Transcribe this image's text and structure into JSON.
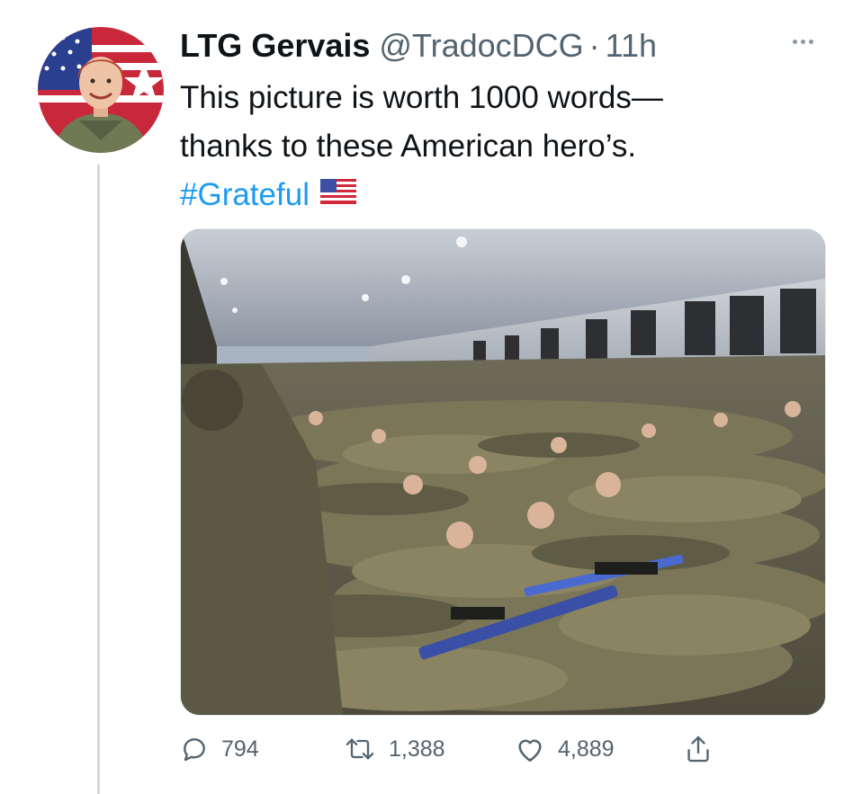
{
  "tweet": {
    "author": {
      "display_name": "LTG Gervais",
      "handle": "@TradocDCG",
      "separator": "·",
      "time": "11h"
    },
    "text_lines": [
      "This picture is worth 1000 words—",
      "thanks to these American hero’s."
    ],
    "hashtag": "#Grateful",
    "flag_emoji": "us-flag-icon",
    "media_description": "photo-soldiers-resting-in-cargo-aircraft",
    "metrics": {
      "replies": "794",
      "retweets": "1,388",
      "likes": "4,889"
    }
  },
  "colors": {
    "link": "#1d9bf0",
    "secondary_text": "#536471",
    "primary_text": "#0f1419",
    "thread_line": "#cfd9de"
  }
}
